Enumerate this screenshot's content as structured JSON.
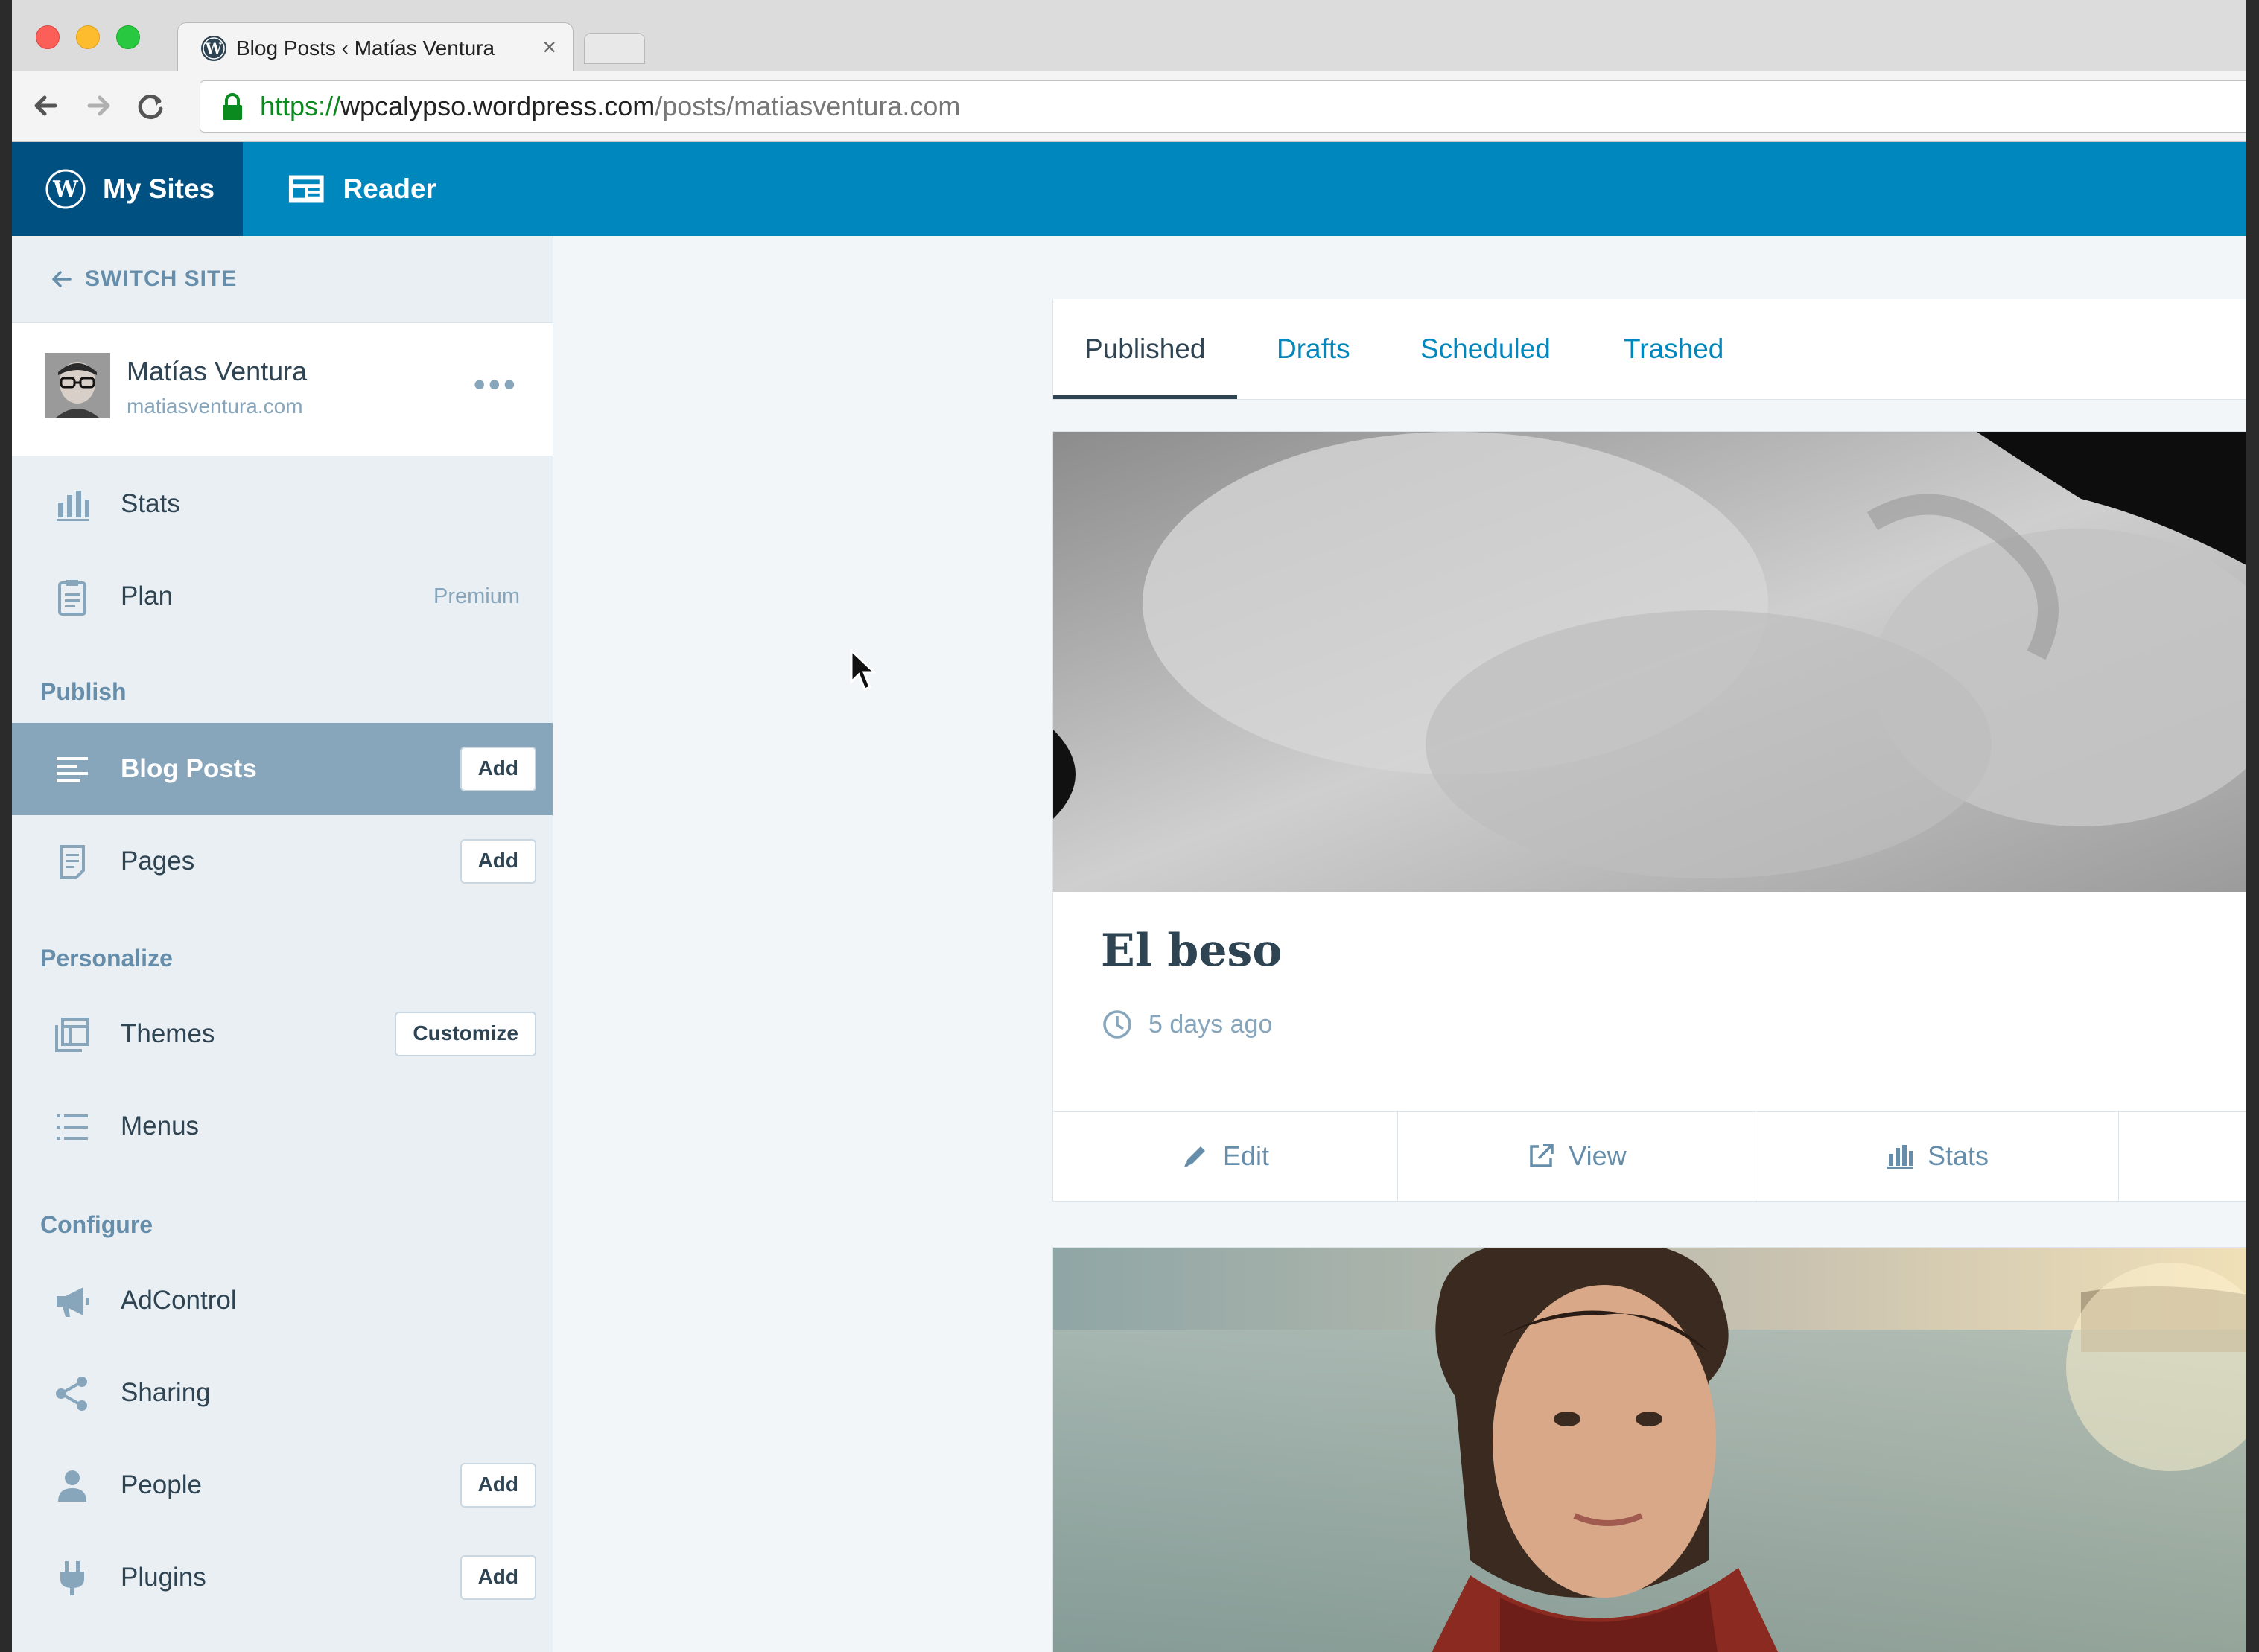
{
  "browser": {
    "tab_title": "Blog Posts ‹ Matías Ventura",
    "tab_close": "×",
    "url_protocol": "https://",
    "url_host": "wpcalypso.wordpress.com",
    "url_path": "/posts/matiasventura.com"
  },
  "masterbar": {
    "my_sites": "My Sites",
    "reader": "Reader"
  },
  "sidebar": {
    "switch_site": "SWITCH SITE",
    "site_name": "Matías Ventura",
    "site_url": "matiasventura.com",
    "more": "•••",
    "stats": "Stats",
    "plan": "Plan",
    "plan_tag": "Premium",
    "publish_heading": "Publish",
    "blog_posts": "Blog Posts",
    "blog_posts_add": "Add",
    "pages": "Pages",
    "pages_add": "Add",
    "personalize_heading": "Personalize",
    "themes": "Themes",
    "themes_customize": "Customize",
    "menus": "Menus",
    "configure_heading": "Configure",
    "adcontrol": "AdControl",
    "sharing": "Sharing",
    "people": "People",
    "people_add": "Add",
    "plugins": "Plugins",
    "plugins_add": "Add"
  },
  "section_nav": {
    "tabs": [
      "Published",
      "Drafts",
      "Scheduled",
      "Trashed"
    ],
    "selected": "Published"
  },
  "posts": [
    {
      "title": "El beso",
      "time": "5 days ago",
      "actions": [
        "Edit",
        "View",
        "Stats"
      ]
    }
  ],
  "colors": {
    "masterbar": "#0087be",
    "masterbar_active": "#005082",
    "sidebar_bg": "#e9eff3",
    "sidebar_active": "#87a6bc",
    "text_dark": "#2e4453",
    "link_blue": "#0087be"
  }
}
